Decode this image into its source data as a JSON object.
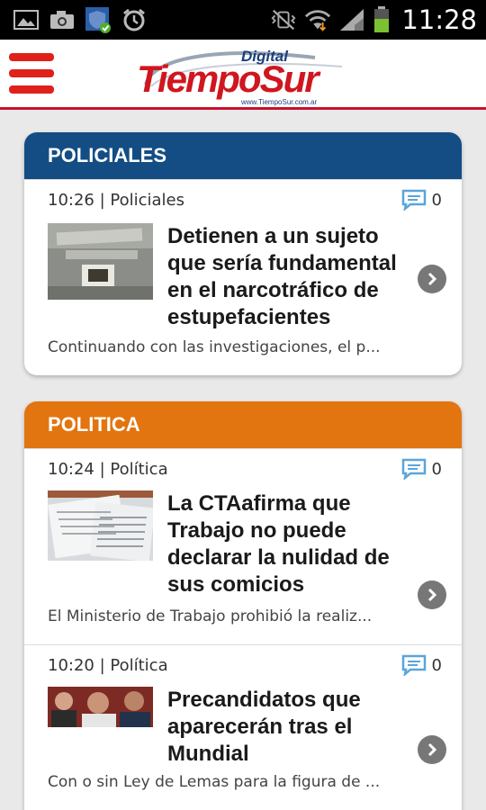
{
  "status_bar": {
    "time": "11:28",
    "left_icons": [
      "gallery-icon",
      "camera-icon",
      "shield-check-icon",
      "alarm-icon"
    ],
    "right_icons": [
      "vibrate-mute-icon",
      "wifi-icon",
      "signal-icon",
      "battery-icon"
    ]
  },
  "header": {
    "logo_top": "Digital",
    "logo_main": "TiempoSur",
    "logo_url": "www.TiempoSur.com.ar",
    "menu_icon": "hamburger-menu-icon"
  },
  "colors": {
    "accent_red": "#e0201b",
    "policiales_header": "#134d84",
    "politica_header": "#e2750f"
  },
  "sections": [
    {
      "title": "POLICIALES",
      "articles": [
        {
          "meta": "10:26 | Policiales",
          "comments": "0",
          "headline": "Detienen a un sujeto que sería fundamental en el narcotráfico de estupefacientes",
          "snippet": "Continuando con las investigaciones, el p..."
        }
      ]
    },
    {
      "title": "POLITICA",
      "articles": [
        {
          "meta": "10:24 | Política",
          "comments": "0",
          "headline": "La CTAafirma que Trabajo no puede declarar la nulidad de sus comicios",
          "snippet": "El Ministerio de Trabajo prohibió la realiz..."
        },
        {
          "meta": "10:20 | Política",
          "comments": "0",
          "headline": "Precandidatos que aparecerán tras el Mundial",
          "snippet": "Con o sin Ley de Lemas para la figura de ..."
        }
      ]
    }
  ]
}
